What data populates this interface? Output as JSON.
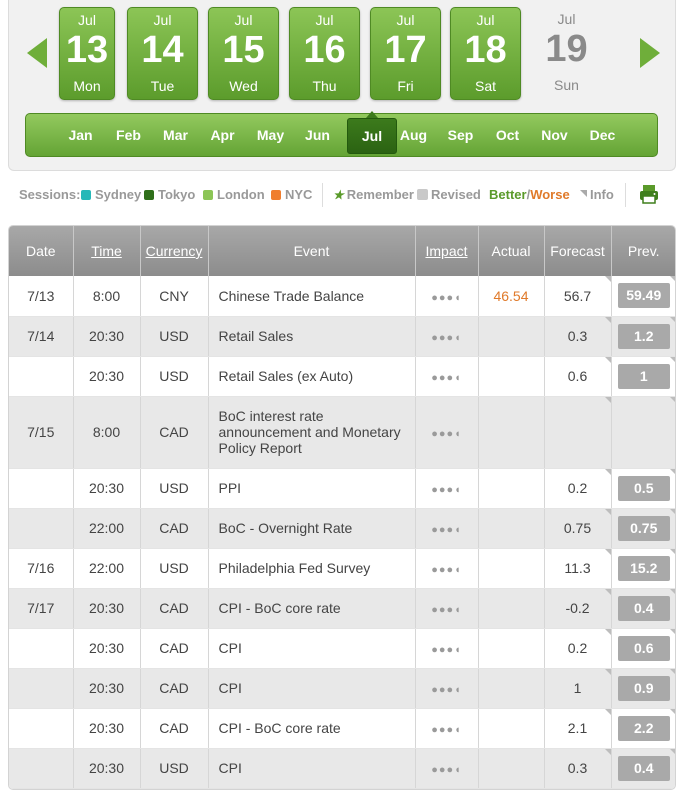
{
  "days": [
    {
      "month": "Jul",
      "day": "13",
      "dow": "Mon",
      "state": "partial"
    },
    {
      "month": "Jul",
      "day": "14",
      "dow": "Tue",
      "state": "green"
    },
    {
      "month": "Jul",
      "day": "15",
      "dow": "Wed",
      "state": "green"
    },
    {
      "month": "Jul",
      "day": "16",
      "dow": "Thu",
      "state": "green"
    },
    {
      "month": "Jul",
      "day": "17",
      "dow": "Fri",
      "state": "green"
    },
    {
      "month": "Jul",
      "day": "18",
      "dow": "Sat",
      "state": "green"
    },
    {
      "month": "Jul",
      "day": "19",
      "dow": "Sun",
      "state": "plain"
    }
  ],
  "months": [
    "Jan",
    "Feb",
    "Mar",
    "Apr",
    "May",
    "Jun",
    "Jul",
    "Aug",
    "Sep",
    "Oct",
    "Nov",
    "Dec"
  ],
  "active_month": "Jul",
  "legend": {
    "sessions_label": "Sessions:",
    "sydney": "Sydney",
    "tokyo": "Tokyo",
    "london": "London",
    "nyc": "NYC",
    "remember": "Remember",
    "revised": "Revised",
    "better": "Better",
    "slash": "/",
    "worse": "Worse",
    "info": "Info"
  },
  "colors": {
    "sydney": "#26b8b8",
    "tokyo": "#2f6f1a",
    "london": "#8cc556",
    "nyc": "#f07e2e",
    "accent_green": "#6fae3a",
    "worse_orange": "#e07a2a"
  },
  "table": {
    "headers": {
      "date": "Date",
      "time": "Time",
      "currency": "Currency",
      "event": "Event",
      "impact": "Impact",
      "actual": "Actual",
      "forecast": "Forecast",
      "prev": "Prev."
    },
    "rows": [
      {
        "date": "7/13",
        "time": "8:00",
        "currency": "CNY",
        "event": "Chinese Trade Balance",
        "impact": "●●●◖",
        "actual": "46.54",
        "forecast": "56.7",
        "prev": "59.49"
      },
      {
        "date": "7/14",
        "time": "20:30",
        "currency": "USD",
        "event": "Retail Sales",
        "impact": "●●●◖",
        "actual": "",
        "forecast": "0.3",
        "prev": "1.2"
      },
      {
        "date": "",
        "time": "20:30",
        "currency": "USD",
        "event": "Retail Sales (ex Auto)",
        "impact": "●●●◖",
        "actual": "",
        "forecast": "0.6",
        "prev": "1"
      },
      {
        "date": "7/15",
        "time": "8:00",
        "currency": "CAD",
        "event": "BoC interest rate announcement and Monetary Policy Report",
        "impact": "●●●◖",
        "actual": "",
        "forecast": "",
        "prev": ""
      },
      {
        "date": "",
        "time": "20:30",
        "currency": "USD",
        "event": "PPI",
        "impact": "●●●◖",
        "actual": "",
        "forecast": "0.2",
        "prev": "0.5"
      },
      {
        "date": "",
        "time": "22:00",
        "currency": "CAD",
        "event": "BoC - Overnight Rate",
        "impact": "●●●◖",
        "actual": "",
        "forecast": "0.75",
        "prev": "0.75"
      },
      {
        "date": "7/16",
        "time": "22:00",
        "currency": "USD",
        "event": "Philadelphia Fed Survey",
        "impact": "●●●◖",
        "actual": "",
        "forecast": "11.3",
        "prev": "15.2"
      },
      {
        "date": "7/17",
        "time": "20:30",
        "currency": "CAD",
        "event": "CPI - BoC core rate",
        "impact": "●●●◖",
        "actual": "",
        "forecast": "-0.2",
        "prev": "0.4"
      },
      {
        "date": "",
        "time": "20:30",
        "currency": "CAD",
        "event": "CPI",
        "impact": "●●●◖",
        "actual": "",
        "forecast": "0.2",
        "prev": "0.6"
      },
      {
        "date": "",
        "time": "20:30",
        "currency": "CAD",
        "event": "CPI",
        "impact": "●●●◖",
        "actual": "",
        "forecast": "1",
        "prev": "0.9"
      },
      {
        "date": "",
        "time": "20:30",
        "currency": "CAD",
        "event": "CPI - BoC core rate",
        "impact": "●●●◖",
        "actual": "",
        "forecast": "2.1",
        "prev": "2.2"
      },
      {
        "date": "",
        "time": "20:30",
        "currency": "USD",
        "event": "CPI",
        "impact": "●●●◖",
        "actual": "",
        "forecast": "0.3",
        "prev": "0.4"
      }
    ]
  }
}
